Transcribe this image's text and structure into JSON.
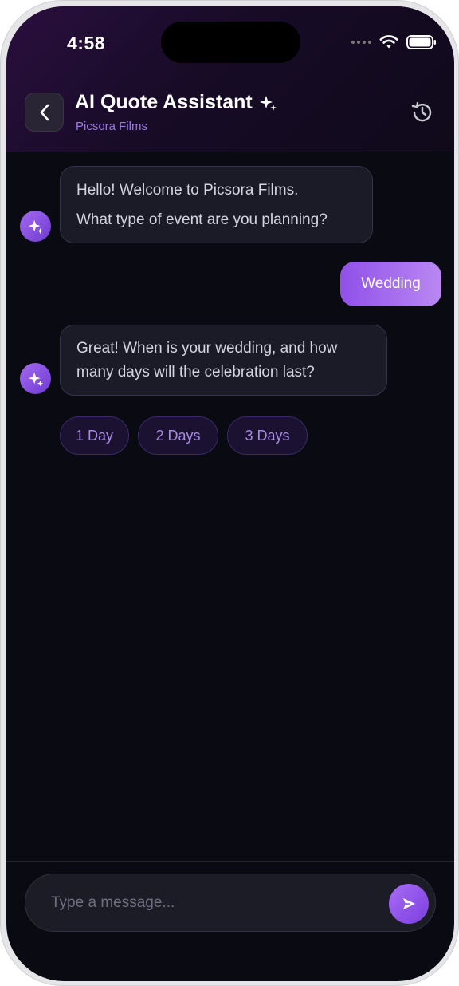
{
  "status_bar": {
    "time": "4:58"
  },
  "header": {
    "title": "AI Quote Assistant",
    "subtitle": "Picsora Films"
  },
  "messages": [
    {
      "sender": "bot",
      "lines": [
        "Hello! Welcome to Picsora Films.",
        "What type of event are you planning?"
      ]
    },
    {
      "sender": "user",
      "text": "Wedding"
    },
    {
      "sender": "bot",
      "lines": [
        "Great! When is your wedding, and how",
        "many days will the celebration last?"
      ]
    }
  ],
  "quick_replies": [
    "1 Day",
    "2 Days",
    "3 Days"
  ],
  "composer": {
    "placeholder": "Type a message..."
  },
  "icons": {
    "back": "chevron-left-icon",
    "title_badge": "sparkle-icon",
    "history": "history-icon",
    "avatar": "sparkle-icon",
    "send": "send-icon"
  },
  "colors": {
    "accent": "#9a5cf0",
    "background": "#0a0a12",
    "bot_bubble": "#1b1b27",
    "subtitle": "#9d7ae0"
  }
}
